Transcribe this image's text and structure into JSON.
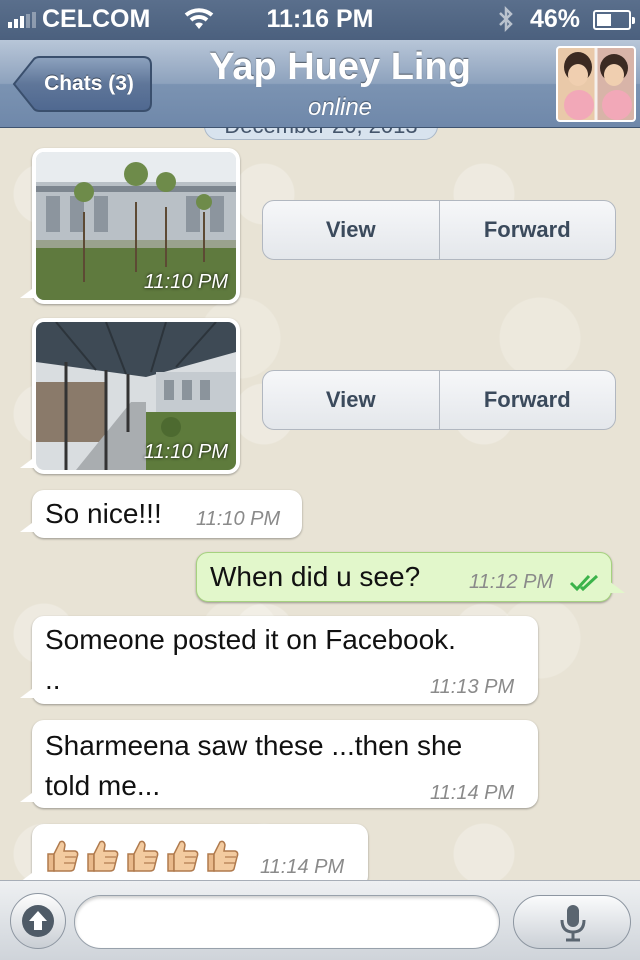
{
  "status_bar": {
    "carrier": "CELCOM",
    "time": "11:16 PM",
    "battery": "46%",
    "battery_level": 0.46
  },
  "header": {
    "back_label": "Chats (3)",
    "title": "Yap Huey Ling",
    "subtitle": "online"
  },
  "date_separator": "December 20, 2013",
  "messages": [
    {
      "type": "image",
      "direction": "incoming",
      "time": "11:10 PM",
      "actions": [
        "View",
        "Forward"
      ],
      "image_desc": "building-courtyard-photo"
    },
    {
      "type": "image",
      "direction": "incoming",
      "time": "11:10 PM",
      "actions": [
        "View",
        "Forward"
      ],
      "image_desc": "covered-walkway-photo"
    },
    {
      "type": "text",
      "direction": "incoming",
      "text": "So nice!!!",
      "time": "11:10 PM"
    },
    {
      "type": "text",
      "direction": "outgoing",
      "text": "When did u see?",
      "time": "11:12 PM",
      "status": "read"
    },
    {
      "type": "text",
      "direction": "incoming",
      "text_lines": [
        "Someone posted it on Facebook.",
        ".."
      ],
      "time": "11:13 PM"
    },
    {
      "type": "text",
      "direction": "incoming",
      "text_lines": [
        "Sharmeena saw these ...then she",
        "told me..."
      ],
      "time": "11:14 PM"
    },
    {
      "type": "emoji",
      "direction": "incoming",
      "emoji_count": 5,
      "emoji": "thumbs-up",
      "time": "11:14 PM"
    }
  ],
  "input": {
    "placeholder": "",
    "value": ""
  },
  "icons": {
    "attach": "upload-arrow-icon",
    "mic": "microphone-icon",
    "read_receipt": "double-check-icon"
  },
  "colors": {
    "nav": "#7b93b2",
    "outgoing_bubble": "#e2f7cb",
    "read_check": "#3bb34a"
  }
}
